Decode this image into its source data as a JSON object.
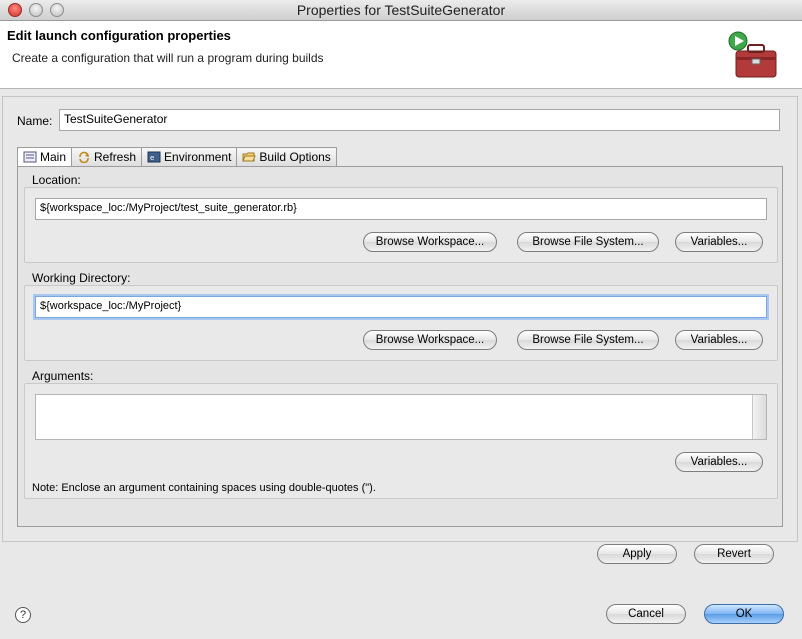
{
  "window": {
    "title": "Properties for TestSuiteGenerator"
  },
  "header": {
    "title": "Edit launch configuration properties",
    "subtitle": "Create a configuration that will run a program during builds"
  },
  "name": {
    "label": "Name:",
    "value": "TestSuiteGenerator"
  },
  "tabs": [
    {
      "label": "Main",
      "icon": "main-tab-icon",
      "active": true
    },
    {
      "label": "Refresh",
      "icon": "refresh-icon"
    },
    {
      "label": "Environment",
      "icon": "environment-icon"
    },
    {
      "label": "Build Options",
      "icon": "folder-open-icon"
    }
  ],
  "location": {
    "label": "Location:",
    "value": "${workspace_loc:/MyProject/test_suite_generator.rb}",
    "browse_workspace": "Browse Workspace...",
    "browse_file_system": "Browse File System...",
    "variables": "Variables..."
  },
  "working_directory": {
    "label": "Working Directory:",
    "value": "${workspace_loc:/MyProject}",
    "browse_workspace": "Browse Workspace...",
    "browse_file_system": "Browse File System...",
    "variables": "Variables..."
  },
  "arguments": {
    "label": "Arguments:",
    "value": "",
    "variables": "Variables...",
    "note": "Note: Enclose an argument containing spaces using double-quotes (\")."
  },
  "actions": {
    "apply": "Apply",
    "revert": "Revert",
    "cancel": "Cancel",
    "ok": "OK",
    "help": "?"
  },
  "colors": {
    "accent": "#5a9de6",
    "focus_ring": "#a8c8f0"
  }
}
